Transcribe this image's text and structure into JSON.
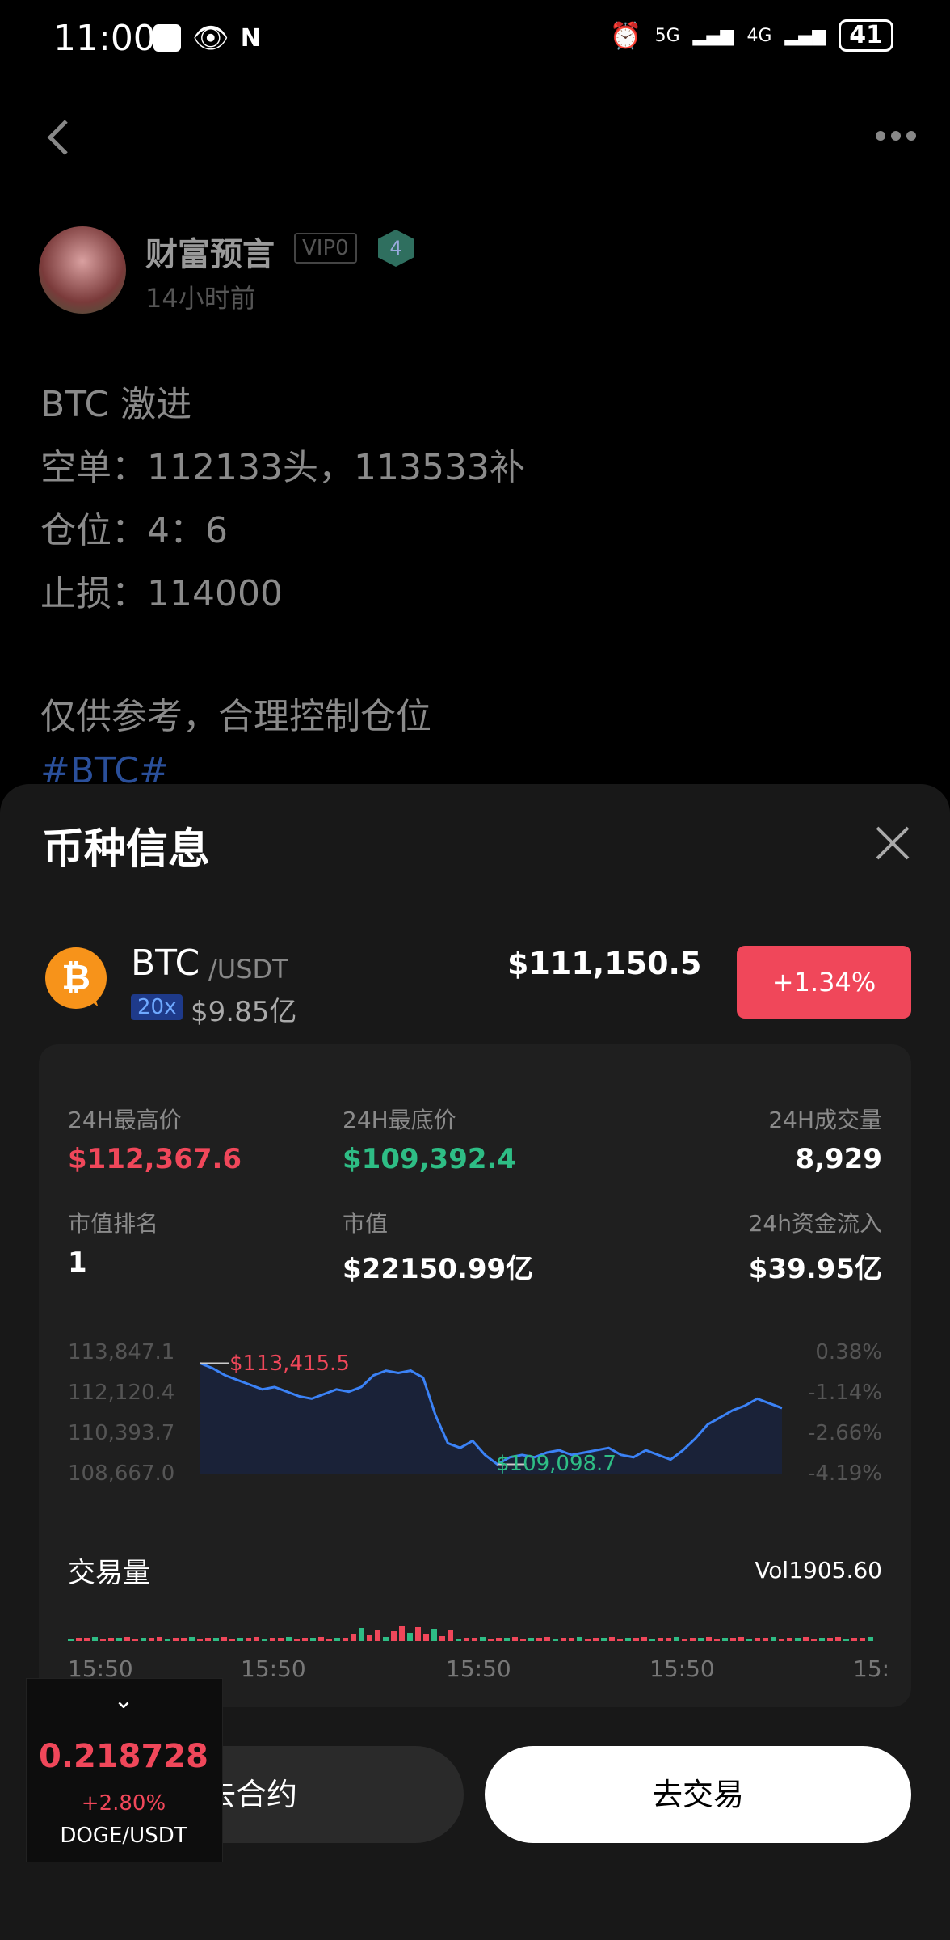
{
  "status": {
    "time": "11:00",
    "network1": "5G",
    "network2": "4G",
    "battery": "41"
  },
  "post": {
    "username": "财富预言",
    "vip": "VIP0",
    "level": "4",
    "time": "14小时前",
    "lines": [
      "BTC 激进",
      "空单：112133头，113533补",
      "仓位：4：6",
      "止损：114000",
      "仅供参考，合理控制仓位"
    ],
    "hashtag": "#BTC#"
  },
  "sheet": {
    "title": "币种信息",
    "coin": {
      "symbol": "BTC",
      "pair": "/USDT",
      "leverage": "20x",
      "cap": "$9.85亿",
      "price": "$111,150.5",
      "change": "+1.34%"
    },
    "stats": {
      "high_label": "24H最高价",
      "high": "$112,367.6",
      "low_label": "24H最底价",
      "low": "$109,392.4",
      "vol_label": "24H成交量",
      "vol": "8,929",
      "rank_label": "市值排名",
      "rank": "1",
      "mcap_label": "市值",
      "mcap": "$22150.99亿",
      "flow_label": "24h资金流入",
      "flow": "$39.95亿"
    },
    "chart": {
      "y_ticks": [
        "113,847.1",
        "112,120.4",
        "110,393.7",
        "108,667.0"
      ],
      "pct_ticks": [
        "0.38%",
        "-1.14%",
        "-2.66%",
        "-4.19%"
      ],
      "max_label": "$113,415.5",
      "min_label": "$109,098.7"
    },
    "volume": {
      "title": "交易量",
      "value": "Vol1905.60",
      "times": [
        "15:50",
        "15:50",
        "15:50",
        "15:50",
        "15:"
      ]
    },
    "buttons": {
      "contract": "去合约",
      "trade": "去交易"
    }
  },
  "ticker": {
    "price": "0.218728",
    "change": "+2.80%",
    "pair": "DOGE/USDT"
  },
  "chart_data": {
    "type": "line",
    "title": "",
    "xlabel": "",
    "ylabel": "",
    "ylim": [
      108667.0,
      113847.1
    ],
    "values": [
      113415.5,
      113200,
      112900,
      112700,
      112500,
      112300,
      112400,
      112200,
      112000,
      111900,
      112100,
      112300,
      112200,
      112400,
      112900,
      113100,
      113000,
      113100,
      112800,
      111200,
      110000,
      109800,
      110100,
      109500,
      109098.7,
      109400,
      109500,
      109400,
      109600,
      109700,
      109500,
      109600,
      109700,
      109800,
      109500,
      109400,
      109700,
      109500,
      109300,
      109700,
      110200,
      110800,
      111100,
      111400,
      111600,
      111900,
      111700,
      111500
    ]
  }
}
